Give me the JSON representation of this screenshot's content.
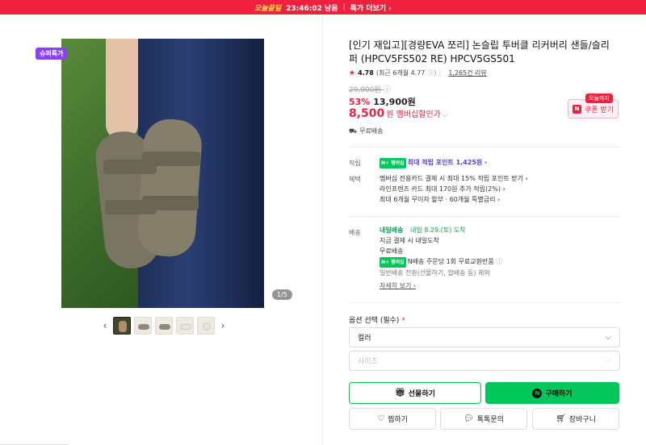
{
  "banner": {
    "brand": "오늘끝딜",
    "countdown": "23:46:02 남음",
    "more": "특가 더보기 ›"
  },
  "gallery": {
    "badge": "슈퍼특가",
    "counter": "1/5",
    "prev": "‹",
    "next": "›",
    "thumb_count": 5
  },
  "product": {
    "title": "[인기 재입고][경량EVA 쪼리] 논슬립 투버클 리커버리 샌들/슬리퍼 (HPCV5FS502 RE) HPCV5GS501",
    "rating": "4.78",
    "rating_note": "(최근 6개월 4.77",
    "reviews": "1,265건 리뷰",
    "original_price": "29,900원",
    "discount_pct": "53%",
    "sale_price": "13,900원",
    "member_price": "8,500",
    "member_suffix": "원 멤버십할인가",
    "coupon_tag": "오늘까지",
    "coupon_label": "쿠폰 받기",
    "free_ship": "무료배송"
  },
  "benefits": {
    "points_label": "적립",
    "points_text": "최대 적립 포인트 1,425원 ›",
    "perks_label": "혜택",
    "perks": [
      "멤버십 전용카드 결제 시 최대 15% 적립 포인트 받기 ›",
      "라인프렌즈 카드 최대 170원 추가 적립(2%) ›",
      "최대 6개월 무이자 할부 · 60개월 특별금리 ›"
    ]
  },
  "delivery": {
    "label": "배송",
    "tomorrow": "내일배송",
    "eta": "내일 8.29.(토) 도착",
    "lines": [
      "지금 결제 시 내일도착",
      "무료배송",
      "N배송 주문당 1회 무료교환반품",
      "일반배송 전환(선물하기, 합배송 등) 제외"
    ],
    "detail": "자세히 보기 ›"
  },
  "options": {
    "label": "옵션 선택 (필수)",
    "required_mark": "*",
    "color": "컬러",
    "size": "사이즈"
  },
  "buttons": {
    "gift": "선물하기",
    "buy": "구매하기",
    "wish": "찜하기",
    "talk": "톡톡문의",
    "cart": "장바구니"
  },
  "colors": {
    "accent": "#f0213f",
    "naver_green": "#03c75a"
  }
}
